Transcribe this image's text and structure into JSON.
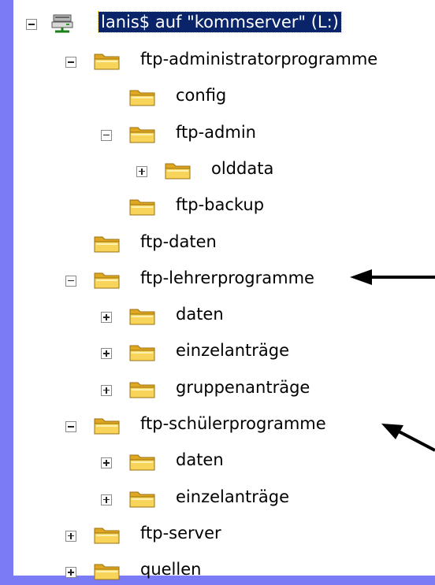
{
  "tree": {
    "root": {
      "label": "lanis$ auf \"kommserver\" (L:)",
      "expander": "minus",
      "icon": "network-drive-icon"
    },
    "items": [
      {
        "label": "ftp-administratorprogramme",
        "level": 1,
        "expander": "minus"
      },
      {
        "label": "config",
        "level": 2,
        "expander": "none"
      },
      {
        "label": "ftp-admin",
        "level": 2,
        "expander": "minus"
      },
      {
        "label": "olddata",
        "level": 3,
        "expander": "plus"
      },
      {
        "label": "ftp-backup",
        "level": 2,
        "expander": "none"
      },
      {
        "label": "ftp-daten",
        "level": 1,
        "expander": "none"
      },
      {
        "label": "ftp-lehrerprogramme",
        "level": 1,
        "expander": "minus"
      },
      {
        "label": "daten",
        "level": 2,
        "expander": "plus"
      },
      {
        "label": "einzelanträge",
        "level": 2,
        "expander": "plus"
      },
      {
        "label": "gruppenanträge",
        "level": 2,
        "expander": "plus"
      },
      {
        "label": "ftp-schülerprogramme",
        "level": 1,
        "expander": "minus"
      },
      {
        "label": "daten",
        "level": 2,
        "expander": "plus"
      },
      {
        "label": "einzelanträge",
        "level": 2,
        "expander": "plus"
      },
      {
        "label": "ftp-server",
        "level": 1,
        "expander": "plus"
      },
      {
        "label": "quellen",
        "level": 1,
        "expander": "plus"
      }
    ]
  },
  "annotations": {
    "arrow_color": "#000000",
    "arrow_targets": [
      "ftp-lehrerprogramme",
      "ftp-schülerprogramme"
    ]
  },
  "colors": {
    "background": "#7b7bf6",
    "panel": "#ffffff",
    "selection": "#0a246a",
    "folder": "#f0c040"
  }
}
